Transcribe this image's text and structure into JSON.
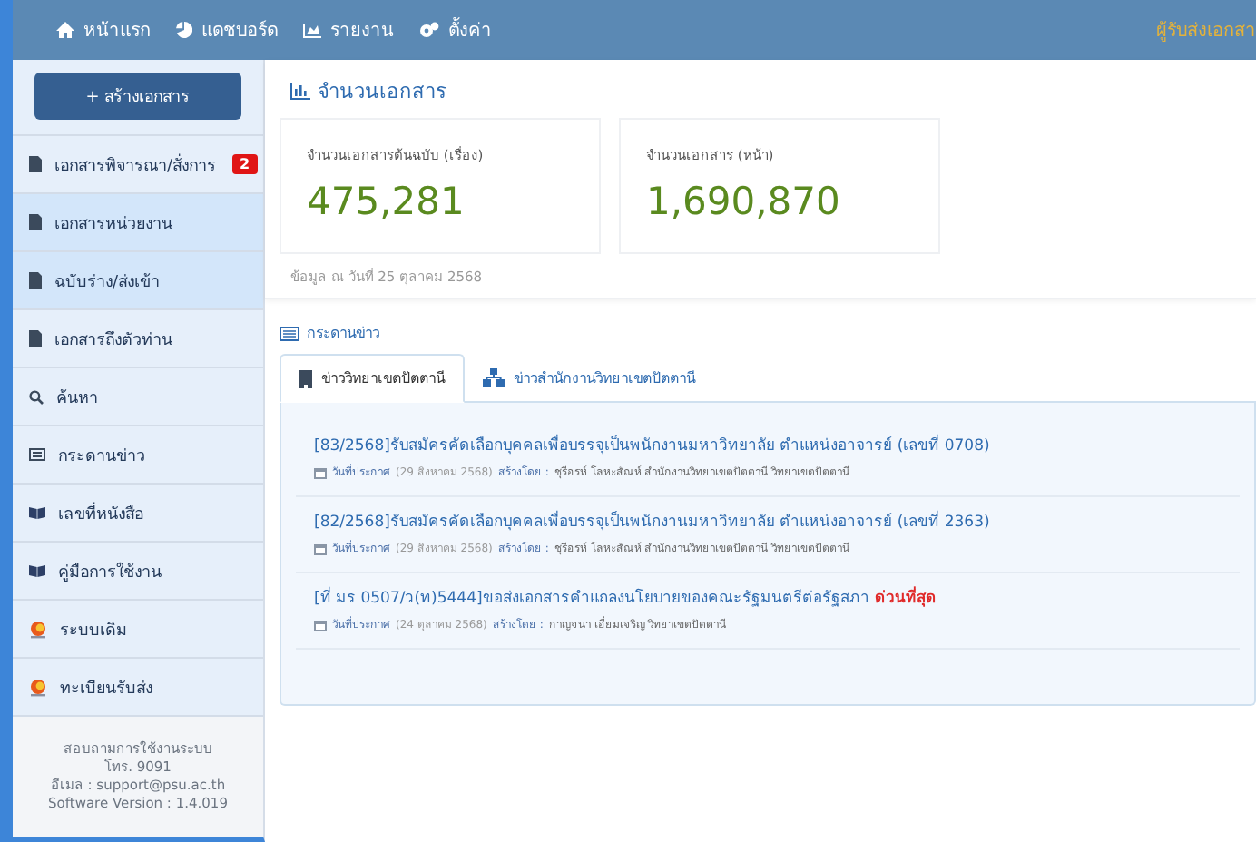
{
  "navbar": {
    "items": [
      {
        "label": "หน้าแรก",
        "kind": "home"
      },
      {
        "label": "แดชบอร์ด",
        "kind": "pie"
      },
      {
        "label": "รายงาน",
        "kind": "chart"
      },
      {
        "label": "ตั้งค่า",
        "kind": "gears"
      }
    ],
    "user": "ผู้รับส่งเอกสา"
  },
  "sidebar": {
    "create_button": "+ สร้างเอกสาร",
    "items": [
      {
        "label": "เอกสารพิจารณา/สั่งการ",
        "kind": "doc",
        "badge": "2",
        "highlighted": false
      },
      {
        "label": "เอกสารหน่วยงาน",
        "kind": "doc",
        "highlighted": true
      },
      {
        "label": "ฉบับร่าง/ส่งเข้า",
        "kind": "doc",
        "highlighted": true
      },
      {
        "label": "เอกสารถึงตัวท่าน",
        "kind": "doc",
        "highlighted": false
      },
      {
        "label": "ค้นหา",
        "kind": "search",
        "highlighted": false
      },
      {
        "label": "กระดานข่าว",
        "kind": "board",
        "highlighted": false
      },
      {
        "label": "เลขที่หนังสือ",
        "kind": "book",
        "highlighted": false
      },
      {
        "label": "คู่มือการใช้งาน",
        "kind": "book",
        "highlighted": false
      },
      {
        "label": "ระบบเดิม",
        "kind": "logo",
        "highlighted": false
      },
      {
        "label": "ทะเบียนรับส่ง",
        "kind": "logo",
        "highlighted": false
      }
    ],
    "footer": [
      "สอบถามการใช้งานระบบ",
      "โทร. 9091",
      "อีเมล : support@psu.ac.th",
      "Software Version : 1.4.019"
    ]
  },
  "stats": {
    "title": "จำนวนเอกสาร",
    "cards": [
      {
        "label": "จำนวนเอกสารต้นฉบับ (เรื่อง)",
        "value": "475,281"
      },
      {
        "label": "จำนวนเอกสาร (หน้า)",
        "value": "1,690,870"
      }
    ],
    "note": "ข้อมูล ณ วันที่ 25 ตุลาคม 2568"
  },
  "news": {
    "title": "กระดานข่าว",
    "tabs": [
      {
        "label": "ข่าววิทยาเขตปัตตานี",
        "selected": true
      },
      {
        "label": "ข่าวสำนักงานวิทยาเขตปัตตานี",
        "selected": false
      }
    ],
    "items": [
      {
        "title": "[83/2568]รับสมัครคัดเลือกบุคคลเพื่อบรรจุเป็นพนักงานมหาวิทยาลัย ตำแหน่งอาจารย์ (เลขที่ 0708)",
        "date_label": "วันที่ประกาศ",
        "date": "(29 สิงหาคม 2568)",
        "by_label": "สร้างโดย :",
        "author": "ชุรีอรห์ โลหะสัณห์ สำนักงานวิทยาเขตปัตตานี วิทยาเขตปัตตานี"
      },
      {
        "title": "[82/2568]รับสมัครคัดเลือกบุคคลเพื่อบรรจุเป็นพนักงานมหาวิทยาลัย ตำแหน่งอาจารย์ (เลขที่ 2363)",
        "date_label": "วันที่ประกาศ",
        "date": "(29 สิงหาคม 2568)",
        "by_label": "สร้างโดย :",
        "author": "ชุรีอรห์ โลหะสัณห์ สำนักงานวิทยาเขตปัตตานี วิทยาเขตปัตตานี"
      },
      {
        "title": "[ที่ มร 0507/ว(ท)5444]ขอส่งเอกสารคำแถลงนโยบายของคณะรัฐมนตรีต่อรัฐสภา",
        "urgency": "ด่วนที่สุด",
        "date_label": "วันที่ประกาศ",
        "date": "(24 ตุลาคม 2568)",
        "by_label": "สร้างโดย :",
        "author": "กาญจนา เอี่ยมเจริญ วิทยาเขตปัตตานี"
      }
    ]
  }
}
